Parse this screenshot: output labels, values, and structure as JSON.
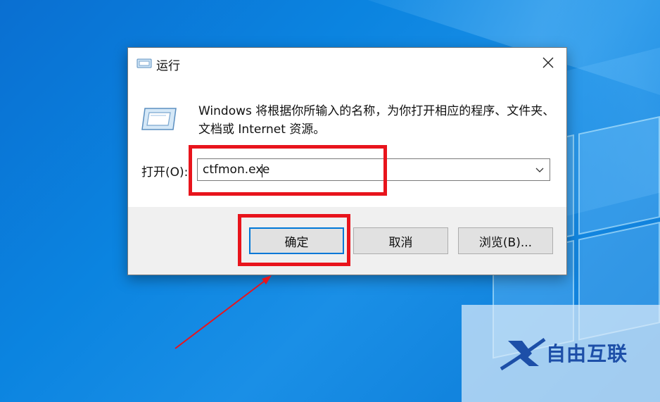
{
  "dialog": {
    "title": "运行",
    "description": "Windows 将根据你所输入的名称，为你打开相应的程序、文件夹、文档或 Internet 资源。",
    "open_label": "打开(O):",
    "command_value": "ctfmon.exe",
    "buttons": {
      "ok": "确定",
      "cancel": "取消",
      "browse": "浏览(B)..."
    }
  },
  "watermark": {
    "text": "自由互联",
    "color": "#1d4fa8"
  },
  "annotation": {
    "highlight_color": "#e8141c"
  },
  "icons": {
    "title": "run-icon",
    "large": "run-icon",
    "close": "close-icon",
    "dropdown": "chevron-down-icon"
  }
}
